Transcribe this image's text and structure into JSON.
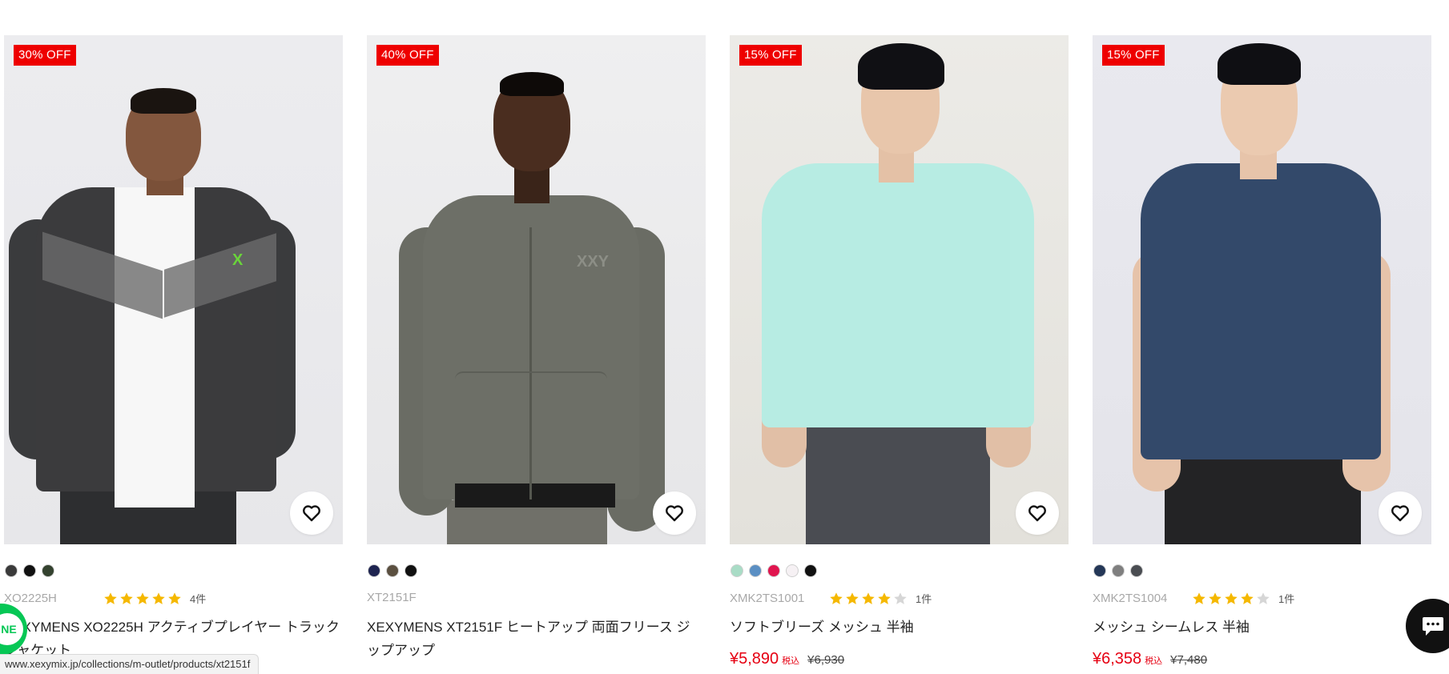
{
  "products": [
    {
      "badge": "30% OFF",
      "sku": "XO2225H",
      "rating": 5,
      "review_count": "4件",
      "title": "XEXYMENS XO2225H アクティブプレイヤー トラックジャケット",
      "price": "",
      "tax_label": "",
      "old_price": "",
      "swatches": [
        "#3a3a3a",
        "#111111",
        "#34422f"
      ],
      "garment_color": "#3b3b3d",
      "wishlist_icon": "heart-outline-icon"
    },
    {
      "badge": "40% OFF",
      "sku": "XT2151F",
      "rating": 0,
      "review_count": "",
      "title": "XEXYMENS XT2151F ヒートアップ 両面フリース ジップアップ",
      "price": "",
      "tax_label": "",
      "old_price": "",
      "swatches": [
        "#1e2450",
        "#5b5040",
        "#111111"
      ],
      "garment_color": "#6d6f67",
      "wishlist_icon": "heart-outline-icon"
    },
    {
      "badge": "15% OFF",
      "sku": "XMK2TS1001",
      "rating": 4,
      "review_count": "1件",
      "title": "ソフトブリーズ メッシュ 半袖",
      "price": "¥5,890",
      "tax_label": "税込",
      "old_price": "¥6,930",
      "swatches": [
        "#a9dcc6",
        "#5b8fc3",
        "#e0154f",
        "#f6f1f4",
        "#111111"
      ],
      "garment_color": "#b7ece3",
      "wishlist_icon": "heart-outline-icon"
    },
    {
      "badge": "15% OFF",
      "sku": "XMK2TS1004",
      "rating": 4,
      "review_count": "1件",
      "title": "メッシュ シームレス 半袖",
      "price": "¥6,358",
      "tax_label": "税込",
      "old_price": "¥7,480",
      "swatches": [
        "#243757",
        "#7f7f7f",
        "#4a4d52"
      ],
      "garment_color": "#33496a",
      "wishlist_icon": "heart-outline-icon"
    }
  ],
  "colors": {
    "badge": "#ee0000",
    "price": "#e60012",
    "star": "#f5b800",
    "star_empty": "#d6d6d6"
  },
  "status_bar": {
    "url": "www.xexymix.jp/collections/m-outlet/products/xt2151f"
  },
  "floating": {
    "line_label": "NE",
    "line_icon": "line-icon",
    "chat_icon": "chat-bubble-icon"
  }
}
